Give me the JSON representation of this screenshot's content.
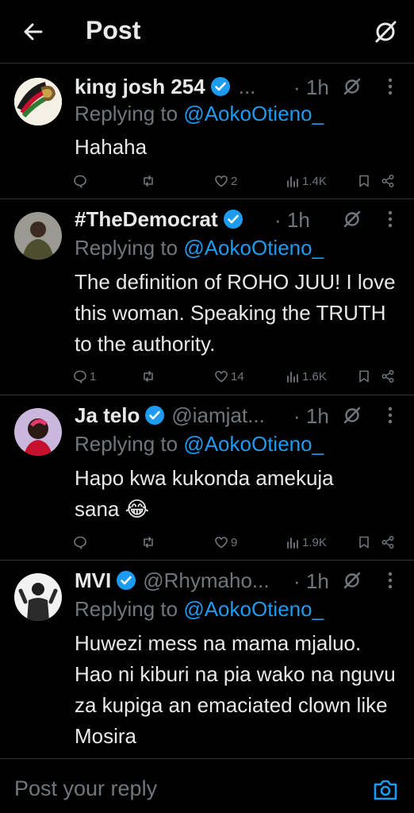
{
  "header": {
    "title": "Post"
  },
  "tweets": [
    {
      "name": "king josh 254",
      "handle": "...",
      "time": "· 1h",
      "reply_prefix": "Replying to",
      "reply_to": "@AokoOtieno_",
      "text": "Hahaha",
      "replies": "",
      "retweets": "",
      "likes": "2",
      "views": "1.4K"
    },
    {
      "name": "#TheDemocrat",
      "handle": "",
      "time": "· 1h",
      "reply_prefix": "Replying to",
      "reply_to": "@AokoOtieno_",
      "text": "The definition of ROHO JUU! I love this woman. Speaking the TRUTH to the authority.",
      "replies": "1",
      "retweets": "",
      "likes": "14",
      "views": "1.6K"
    },
    {
      "name": "Ja telo",
      "handle": "@iamjat...",
      "time": "· 1h",
      "reply_prefix": "Replying to",
      "reply_to": "@AokoOtieno_",
      "text": "Hapo kwa kukonda amekuja sana 😂",
      "replies": "",
      "retweets": "",
      "likes": "9",
      "views": "1.9K"
    },
    {
      "name": "MVI",
      "handle": "@Rhymaho...",
      "time": "· 1h",
      "reply_prefix": "Replying to",
      "reply_to": "@AokoOtieno_",
      "text": "Huwezi mess na mama mjaluo. Hao ni kiburi na pia wako na nguvu za kupiga an emaciated clown like Mosira"
    }
  ],
  "composer": {
    "placeholder": "Post your reply"
  },
  "colors": {
    "background": "#000000",
    "text": "#e7e9ea",
    "muted": "#71767b",
    "accent": "#1d9bf0",
    "divider": "#2f3336"
  }
}
